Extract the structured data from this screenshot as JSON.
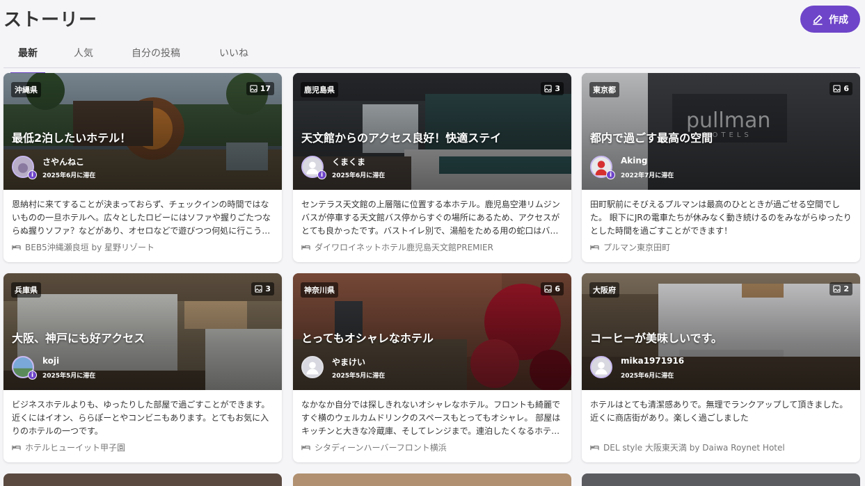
{
  "page": {
    "title": "ストーリー",
    "create_label": "作成"
  },
  "tabs": [
    "最新",
    "人気",
    "自分の投稿",
    "いいね"
  ],
  "cards": [
    {
      "prefecture": "沖縄県",
      "image_count": "17",
      "title": "最低2泊したいホテル！",
      "user": "さやんねこ",
      "stay": "2025年6月に滞在",
      "description": "恩納村に来てすることが決まっておらず、チェックインの時間ではないものの一旦ホテルへ。広々としたロビーにはソファや握りごたつならぬ握りソファ？などがあり、オセロなどで遊びつつ何処に行こうか考えました。",
      "hotel": "BEB5沖縄瀬良垣 by 星野リゾート"
    },
    {
      "prefecture": "鹿児島県",
      "image_count": "3",
      "title": "天文館からのアクセス良好！快適ステイ",
      "user": "くまくま",
      "stay": "2025年6月に滞在",
      "description": "センテラス天文館の上層階に位置する本ホテル。鹿児島空港リムジンバスが停車する天文館バス停からすぐの場所にあるため、アクセスがとても良かったです。バストイレ別で、湯船をためる用の蛇口はバスタブ専用でした。",
      "hotel": "ダイワロイネットホテル鹿児島天文館PREMIER"
    },
    {
      "prefecture": "東京都",
      "image_count": "6",
      "title": "都内で過ごす最高の空間",
      "user": "Aking",
      "stay": "2022年7月に滞在",
      "description": "田町駅前にそびえるプルマンは最高のひとときが過ごせる空間でした。 眼下にJRの電車たちが休みなく動き続けるのをみながらゆったりとした時間を過ごすことができます！",
      "hotel": "プルマン東京田町"
    },
    {
      "prefecture": "兵庫県",
      "image_count": "3",
      "title": "大阪、神戸にも好アクセス",
      "user": "koji",
      "stay": "2025年5月に滞在",
      "description": "ビジネスホテルよりも、ゆったりした部屋で過ごすことができます。近くにはイオン、ららぽーとやコンビニもあります。とてもお気に入りのホテルの一つです。",
      "hotel": "ホテルヒューイット甲子園"
    },
    {
      "prefecture": "神奈川県",
      "image_count": "6",
      "title": "とってもオシャレなホテル",
      "user": "やまけい",
      "stay": "2025年5月に滞在",
      "description": "なかなか自分では探しきれないオシャレなホテル。フロントも綺麗ですぐ横のウェルカムドリンクのスペースもとってもオシャレ。 部屋はキッチンと大きな冷蔵庫、そしてレンジまで。連泊したくなるホテルでした。",
      "hotel": "シタディーンハーバーフロント横浜"
    },
    {
      "prefecture": "大阪府",
      "image_count": "2",
      "title": "コーヒーが美味しいです。",
      "user": "mika1971916",
      "stay": "2025年6月に滞在",
      "description": "ホテルはとても清潔感ありで。無理でランクアップして頂きました。近くに商店街があり。楽しく過ごしました",
      "hotel": "DEL style 大阪東天満 by Daiwa Roynet Hotel"
    }
  ],
  "colors": {
    "accent": "#6e45c9",
    "background": "#f5f5f8"
  },
  "icons": {
    "create": "pencil-icon",
    "image_count": "image-icon",
    "hotel": "bed-icon",
    "default_avatar": "person-icon"
  }
}
